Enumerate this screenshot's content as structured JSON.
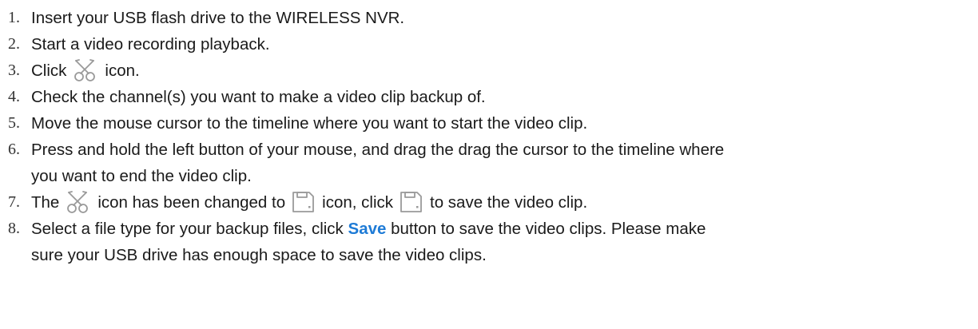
{
  "steps": [
    {
      "num": "1.",
      "text": "Insert your USB flash drive to the WIRELESS NVR."
    },
    {
      "num": "2.",
      "text": "Start a video recording playback."
    },
    {
      "num": "3.",
      "before": "Click",
      "after": "icon."
    },
    {
      "num": "4.",
      "text": "Check the channel(s) you want to make a video clip backup of."
    },
    {
      "num": "5.",
      "text": "Move the mouse cursor to the timeline where you want to start the video clip."
    },
    {
      "num": "6.",
      "line1": "Press and hold the left button of your mouse, and drag the drag the cursor to the timeline where",
      "line2": "you want to end the video clip."
    },
    {
      "num": "7.",
      "part1": "The",
      "part2": "icon has been changed to",
      "part3": "icon, click",
      "part4": "to save the video clip."
    },
    {
      "num": "8.",
      "line1_before": "Select a file type for your backup files, click",
      "line1_bold": "Save",
      "line1_after": "button to save the video clips. Please make",
      "line2": "sure your USB drive has enough space to save the video clips."
    }
  ],
  "icons": {
    "scissors": "scissors-icon",
    "save": "save-icon"
  },
  "colors": {
    "text": "#1a1a1a",
    "number": "#333333",
    "link": "#1e7bd6",
    "icon_stroke": "#999999"
  }
}
